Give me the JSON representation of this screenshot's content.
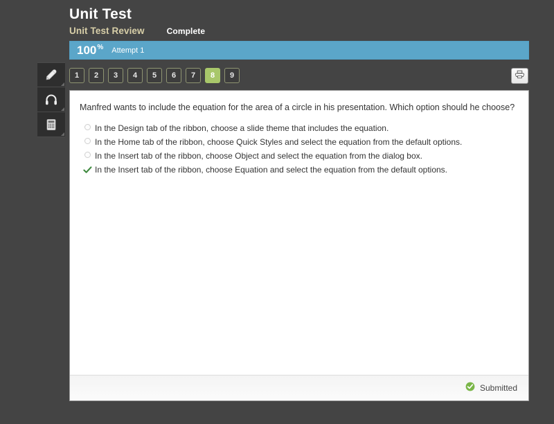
{
  "header": {
    "title": "Unit Test",
    "review_label": "Unit Test Review",
    "status_label": "Complete"
  },
  "score": {
    "value": "100",
    "percent_symbol": "%",
    "attempt_label": "Attempt 1"
  },
  "sidebar": {
    "tools": [
      {
        "name": "pencil-icon",
        "label": "Pencil"
      },
      {
        "name": "headphones-icon",
        "label": "Headphones"
      },
      {
        "name": "calculator-icon",
        "label": "Calculator"
      }
    ]
  },
  "tabs": {
    "items": [
      "1",
      "2",
      "3",
      "4",
      "5",
      "6",
      "7",
      "8",
      "9"
    ],
    "active_index": 7
  },
  "toolbar": {
    "print_label": "Print"
  },
  "question": {
    "text": "Manfred wants to include the equation for the area of a circle in his presentation. Which option should he choose?",
    "options": [
      {
        "text": "In the Design tab of the ribbon, choose a slide theme that includes the equation.",
        "selected": false
      },
      {
        "text": "In the Home tab of the ribbon, choose Quick Styles and select the equation from the default options.",
        "selected": false
      },
      {
        "text": "In the Insert tab of the ribbon, choose Object and select the equation from the dialog box.",
        "selected": false
      },
      {
        "text": "In the Insert tab of the ribbon, choose Equation and select the equation from the default options.",
        "selected": true
      }
    ]
  },
  "footer": {
    "submitted_label": "Submitted"
  },
  "colors": {
    "background": "#444444",
    "score_bar": "#5ba6c9",
    "active_tab": "#a8c76a",
    "review_text": "#d8cfa8",
    "check_green": "#3f8a3f",
    "submitted_green": "#7ab648"
  }
}
